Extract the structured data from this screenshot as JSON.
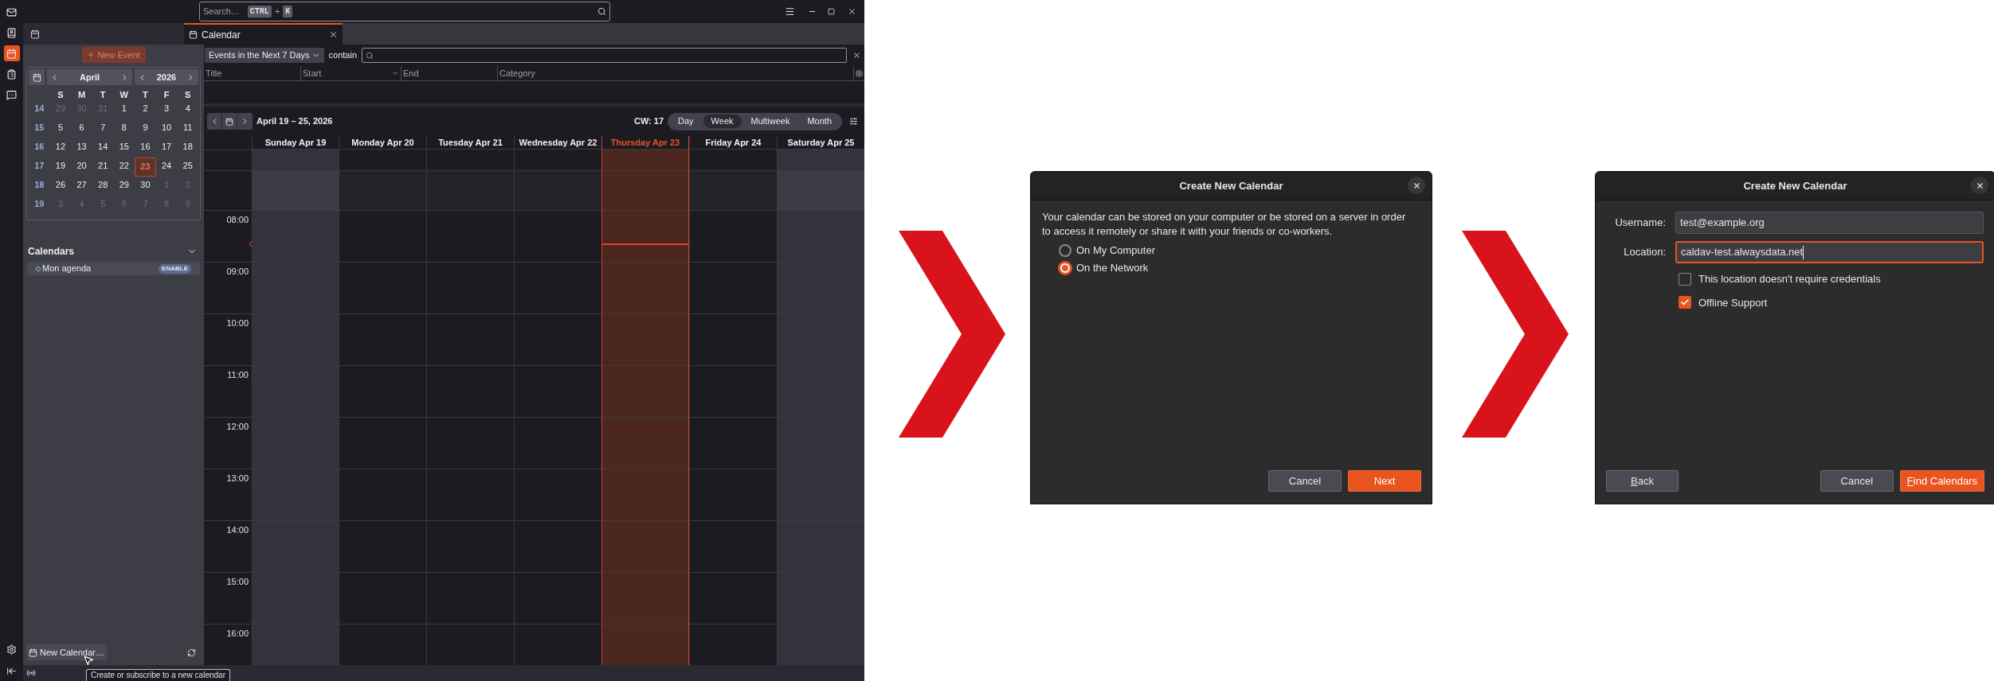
{
  "spaces": [
    {
      "kind": "mail",
      "selected": false
    },
    {
      "kind": "contacts",
      "selected": false
    },
    {
      "kind": "calendar",
      "selected": true
    },
    {
      "kind": "tasks",
      "selected": false
    },
    {
      "kind": "chat",
      "selected": false
    }
  ],
  "search": {
    "placeholder": "Search…",
    "shortcut": [
      {
        "kind": "key",
        "text": "CTRL"
      },
      {
        "kind": "separator",
        "text": "+"
      },
      {
        "kind": "key",
        "text": "K"
      }
    ]
  },
  "tabs": [
    {
      "label": "Calendar",
      "selected": true
    }
  ],
  "sidebar": {
    "new_event": {
      "label": "New Event",
      "disabled": true
    },
    "minimonth": {
      "month": "April",
      "year": "2026",
      "weekdays": [
        "S",
        "M",
        "T",
        "W",
        "T",
        "F",
        "S"
      ],
      "weeks": [
        {
          "number": "14",
          "days": [
            {
              "text": "29",
              "outside": true,
              "selected": false
            },
            {
              "text": "30",
              "outside": true,
              "selected": false
            },
            {
              "text": "31",
              "outside": true,
              "selected": false
            },
            {
              "text": "1",
              "outside": false,
              "selected": false
            },
            {
              "text": "2",
              "outside": false,
              "selected": false
            },
            {
              "text": "3",
              "outside": false,
              "selected": false
            },
            {
              "text": "4",
              "outside": false,
              "selected": false
            }
          ]
        },
        {
          "number": "15",
          "days": [
            {
              "text": "5",
              "outside": false,
              "selected": false
            },
            {
              "text": "6",
              "outside": false,
              "selected": false
            },
            {
              "text": "7",
              "outside": false,
              "selected": false
            },
            {
              "text": "8",
              "outside": false,
              "selected": false
            },
            {
              "text": "9",
              "outside": false,
              "selected": false
            },
            {
              "text": "10",
              "outside": false,
              "selected": false
            },
            {
              "text": "11",
              "outside": false,
              "selected": false
            }
          ]
        },
        {
          "number": "16",
          "days": [
            {
              "text": "12",
              "outside": false,
              "selected": false
            },
            {
              "text": "13",
              "outside": false,
              "selected": false
            },
            {
              "text": "14",
              "outside": false,
              "selected": false
            },
            {
              "text": "15",
              "outside": false,
              "selected": false
            },
            {
              "text": "16",
              "outside": false,
              "selected": false
            },
            {
              "text": "17",
              "outside": false,
              "selected": false
            },
            {
              "text": "18",
              "outside": false,
              "selected": false
            }
          ]
        },
        {
          "number": "17",
          "days": [
            {
              "text": "19",
              "outside": false,
              "selected": false
            },
            {
              "text": "20",
              "outside": false,
              "selected": false
            },
            {
              "text": "21",
              "outside": false,
              "selected": false
            },
            {
              "text": "22",
              "outside": false,
              "selected": false
            },
            {
              "text": "23",
              "outside": false,
              "selected": true
            },
            {
              "text": "24",
              "outside": false,
              "selected": false
            },
            {
              "text": "25",
              "outside": false,
              "selected": false
            }
          ]
        },
        {
          "number": "18",
          "days": [
            {
              "text": "26",
              "outside": false,
              "selected": false
            },
            {
              "text": "27",
              "outside": false,
              "selected": false
            },
            {
              "text": "28",
              "outside": false,
              "selected": false
            },
            {
              "text": "29",
              "outside": false,
              "selected": false
            },
            {
              "text": "30",
              "outside": false,
              "selected": false
            },
            {
              "text": "1",
              "outside": true,
              "selected": false
            },
            {
              "text": "2",
              "outside": true,
              "selected": false
            }
          ]
        },
        {
          "number": "19",
          "days": [
            {
              "text": "3",
              "outside": true,
              "selected": false
            },
            {
              "text": "4",
              "outside": true,
              "selected": false
            },
            {
              "text": "5",
              "outside": true,
              "selected": false
            },
            {
              "text": "6",
              "outside": true,
              "selected": false
            },
            {
              "text": "7",
              "outside": true,
              "selected": false
            },
            {
              "text": "8",
              "outside": true,
              "selected": false
            },
            {
              "text": "9",
              "outside": true,
              "selected": false
            }
          ]
        }
      ]
    },
    "calendars": {
      "title": "Calendars",
      "expanded": true,
      "items": [
        {
          "name": "Mon agenda",
          "badge": "ENABLE"
        }
      ]
    },
    "new_calendar": "New Calendar…",
    "tooltip": "Create or subscribe to a new calendar"
  },
  "filter": {
    "dropdown": "Events in the Next 7 Days",
    "contain_label": "contain"
  },
  "list_columns": [
    {
      "label": "Title",
      "sorted": false
    },
    {
      "label": "Start",
      "sorted": true
    },
    {
      "label": "End",
      "sorted": false
    },
    {
      "label": "Category",
      "sorted": false
    }
  ],
  "week_view": {
    "range": "April 19 – 25, 2026",
    "cw": "CW: 17",
    "views": [
      {
        "label": "Day",
        "selected": false
      },
      {
        "label": "Week",
        "selected": true
      },
      {
        "label": "Multiweek",
        "selected": false
      },
      {
        "label": "Month",
        "selected": false
      }
    ],
    "days": [
      {
        "label": "Sunday Apr 19",
        "kind": "weekend"
      },
      {
        "label": "Monday Apr 20",
        "kind": "weekday"
      },
      {
        "label": "Tuesday Apr 21",
        "kind": "weekday"
      },
      {
        "label": "Wednesday Apr 22",
        "kind": "weekday"
      },
      {
        "label": "Thursday Apr 23",
        "kind": "today"
      },
      {
        "label": "Friday Apr 24",
        "kind": "weekday"
      },
      {
        "label": "Saturday Apr 25",
        "kind": "weekend"
      }
    ],
    "hours": [
      "08:00",
      "09:00",
      "10:00",
      "11:00",
      "12:00",
      "13:00",
      "14:00",
      "15:00",
      "16:00"
    ]
  },
  "dialogs": [
    {
      "kind": "location",
      "title": "Create New Calendar",
      "description": "Your calendar can be stored on your computer or be stored on a server in order to access it remotely or share it with your friends or co-workers.",
      "options": [
        {
          "label": "On My Computer",
          "selected": false
        },
        {
          "label": "On the Network",
          "selected": true
        }
      ],
      "buttons": [
        {
          "label": "Cancel",
          "primary": false,
          "accesskey": false
        },
        {
          "label": "Next",
          "primary": true,
          "accesskey": false
        }
      ]
    },
    {
      "kind": "credentials",
      "title": "Create New Calendar",
      "fields": [
        {
          "label": "Username:",
          "value": "test@example.org",
          "focused": false
        },
        {
          "label": "Location:",
          "value": "caldav-test.alwaysdata.net",
          "focused": true
        }
      ],
      "checkboxes": [
        {
          "label": "This location doesn't require credentials",
          "checked": false
        },
        {
          "label": "Offline Support",
          "checked": true
        }
      ],
      "back_button": {
        "label": "Back",
        "accesskey": true
      },
      "buttons": [
        {
          "label": "Cancel",
          "primary": false,
          "accesskey": false
        },
        {
          "label": "Find Calendars",
          "primary": true,
          "accesskey": true
        }
      ]
    }
  ]
}
